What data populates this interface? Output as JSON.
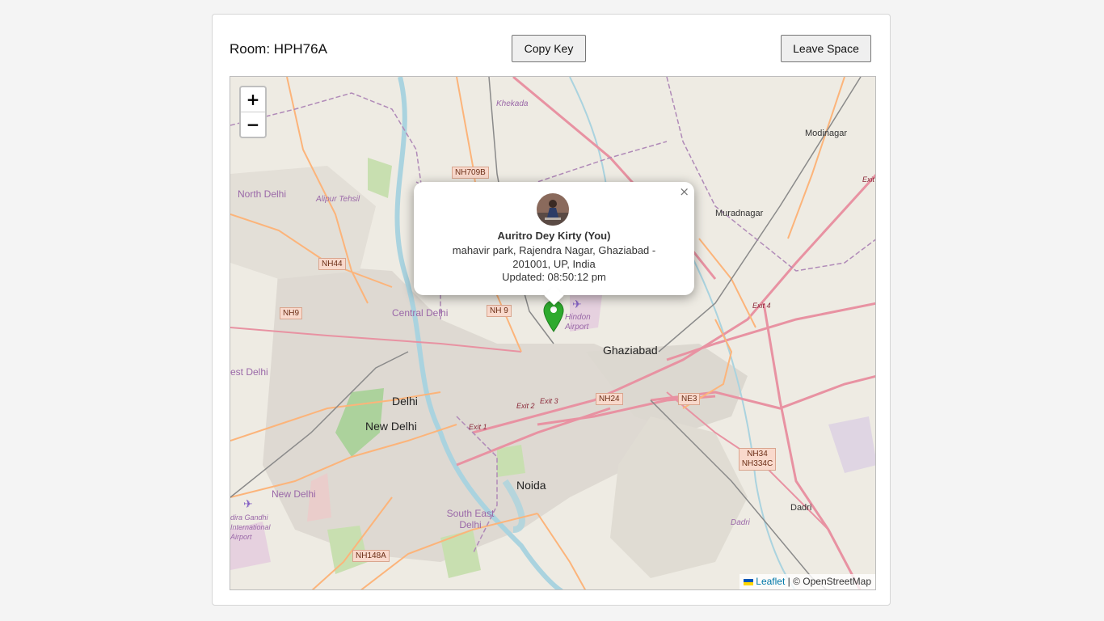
{
  "room": {
    "label": "Room: HPH76A"
  },
  "actions": {
    "copy_label": "Copy Key",
    "leave_label": "Leave Space"
  },
  "map": {
    "zoom_in": "+",
    "zoom_out": "−",
    "attribution_link": "Leaflet",
    "attribution_rest": "| © OpenStreetMap",
    "marker_color": "#2eaa2e",
    "labels": {
      "north_delhi": "North Delhi",
      "alipur": "Alipur Tehsil",
      "khekada": "Khekada",
      "modinagar": "Modinagar",
      "muradnagar": "Muradnagar",
      "central_delhi": "Central Delhi",
      "hindon_airport": "Hindon Airport",
      "ghaziabad": "Ghaziabad",
      "west_delhi": "est Delhi",
      "delhi": "Delhi",
      "new_delhi": "New Delhi",
      "new_delhi_district": "New Delhi",
      "noida": "Noida",
      "south_east_delhi": "South East Delhi",
      "dadri": "Dadri",
      "dadri2": "Dadri",
      "igi_airport": "dira Gandhi International Airport",
      "exit_1": "Exit 1",
      "exit_2": "Exit 2",
      "exit_3": "Exit 3",
      "exit_4": "Exit 4",
      "exit_top": "Exit"
    },
    "shields": {
      "nh709b": "NH709B",
      "nh44": "NH44",
      "nh9a": "NH9",
      "nh9b": "NH 9",
      "nh24": "NH24",
      "ne3": "NE3",
      "nh34": "NH34",
      "nh334c": "NH334C",
      "nh148a": "NH148A"
    }
  },
  "popup": {
    "close": "×",
    "name": "Auritro Dey Kirty (You)",
    "address": "mahavir park, Rajendra Nagar, Ghaziabad - 201001, UP, India",
    "updated": "Updated: 08:50:12 pm"
  }
}
